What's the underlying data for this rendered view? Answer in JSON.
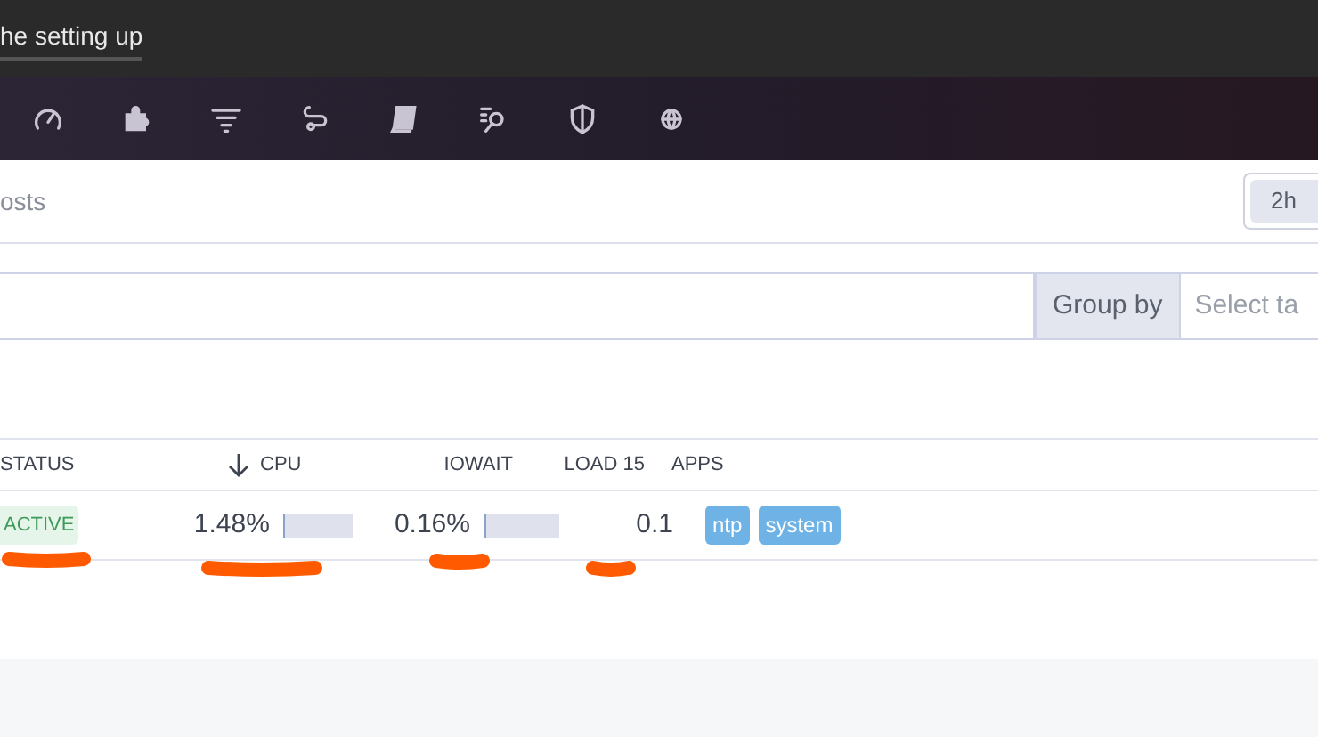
{
  "header": {
    "title": "he setting up"
  },
  "nav": {
    "icons": [
      {
        "kind": "gauge"
      },
      {
        "kind": "puzzle"
      },
      {
        "kind": "filter"
      },
      {
        "kind": "route"
      },
      {
        "kind": "book"
      },
      {
        "kind": "search-list"
      },
      {
        "kind": "shield"
      },
      {
        "kind": "globe"
      }
    ]
  },
  "page": {
    "title": "osts",
    "timeframe": "2h"
  },
  "filter": {
    "group_by": "Group by",
    "placeholder": "Select ta"
  },
  "table": {
    "columns": [
      {
        "label": "STATUS",
        "sorted": false
      },
      {
        "label": "CPU",
        "sorted": true
      },
      {
        "label": "IOWAIT",
        "sorted": false
      },
      {
        "label": "LOAD 15",
        "sorted": false
      },
      {
        "label": "APPS",
        "sorted": false
      }
    ],
    "rows": [
      {
        "status": "ACTIVE",
        "cpu": {
          "reading": "1.48%",
          "level": 0.015
        },
        "iowait": {
          "reading": "0.16%",
          "level": 0.0
        },
        "load": "0.1",
        "apps": [
          "ntp",
          "system"
        ]
      }
    ]
  }
}
